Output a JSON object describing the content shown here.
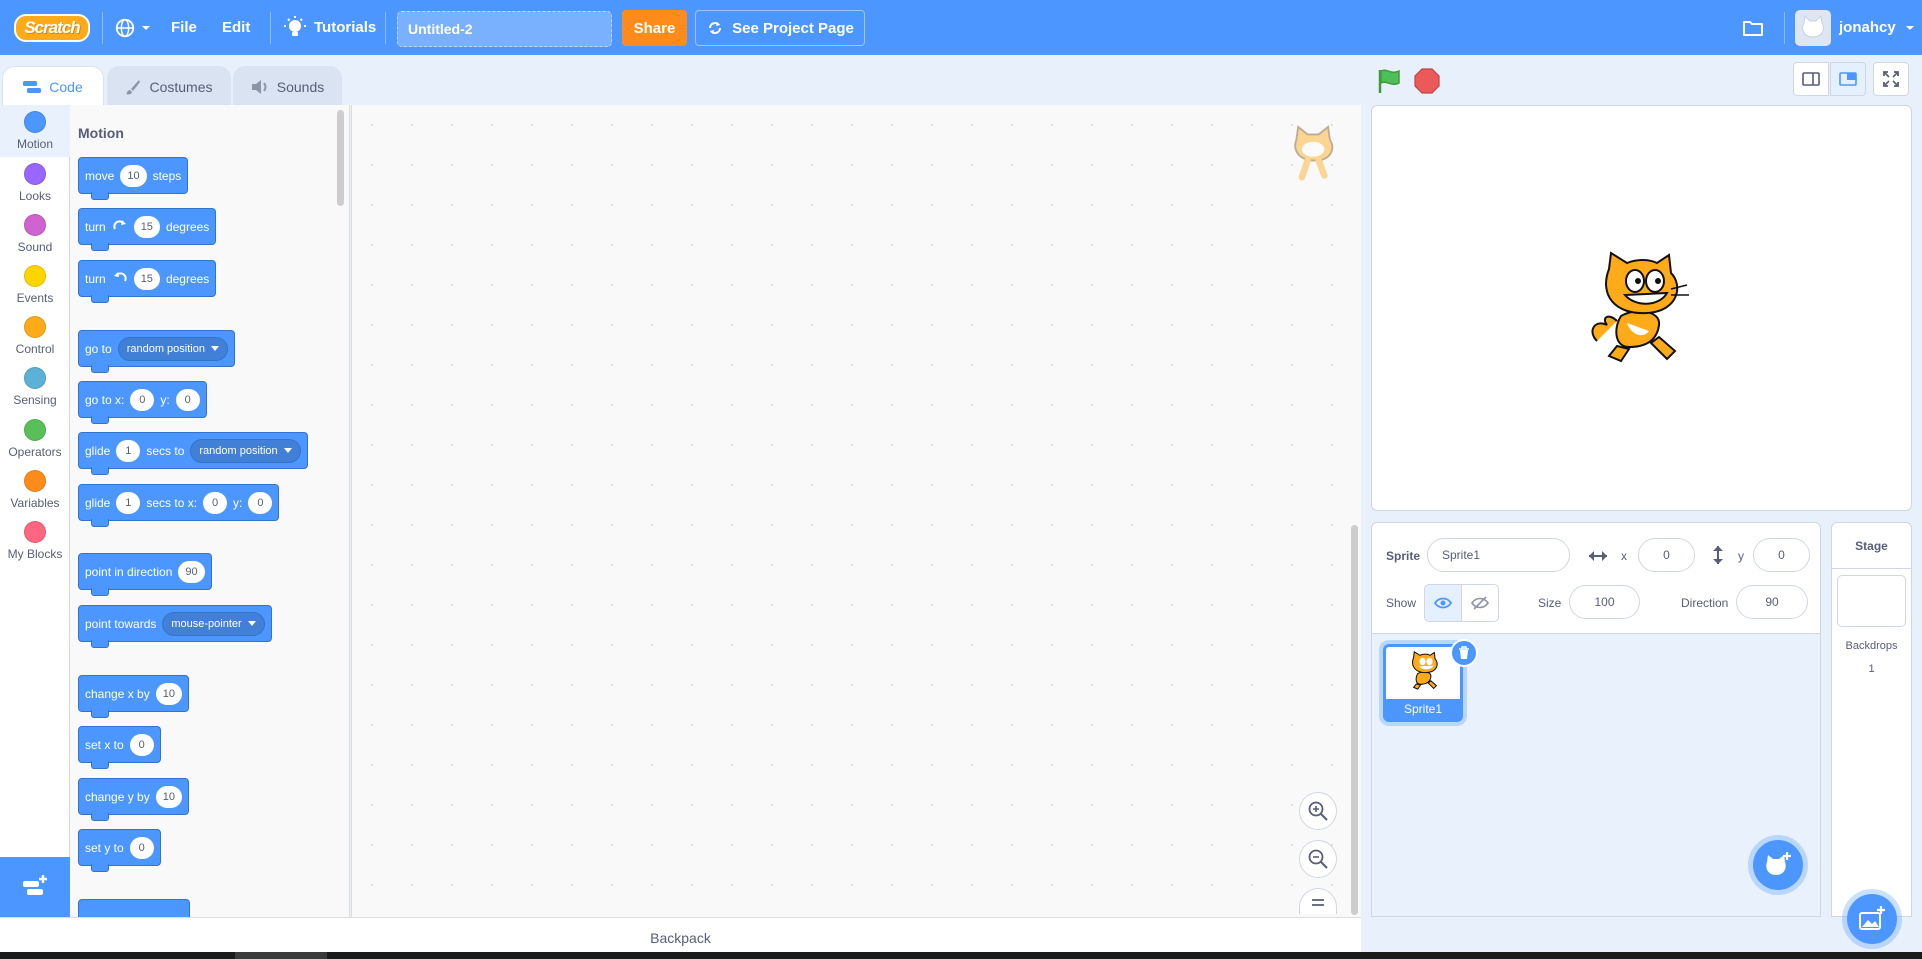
{
  "menubar": {
    "logo_text": "Scratch",
    "file_label": "File",
    "edit_label": "Edit",
    "tutorials_label": "Tutorials",
    "project_title": "Untitled-2",
    "share_label": "Share",
    "see_project_label": "See Project Page",
    "username": "jonahcy",
    "accent": "#4c97ff",
    "share_color": "#ff8c1a"
  },
  "tabs": {
    "code": "Code",
    "costumes": "Costumes",
    "sounds": "Sounds"
  },
  "categories": [
    {
      "label": "Motion",
      "color": "#4c97ff"
    },
    {
      "label": "Looks",
      "color": "#9966ff"
    },
    {
      "label": "Sound",
      "color": "#cf63cf"
    },
    {
      "label": "Events",
      "color": "#ffd500"
    },
    {
      "label": "Control",
      "color": "#ffab19"
    },
    {
      "label": "Sensing",
      "color": "#5cb1d6"
    },
    {
      "label": "Operators",
      "color": "#59c059"
    },
    {
      "label": "Variables",
      "color": "#ff8c1a"
    },
    {
      "label": "My Blocks",
      "color": "#ff6680"
    }
  ],
  "palette": {
    "section_title": "Motion",
    "move": {
      "a": "move",
      "v": "10",
      "b": "steps"
    },
    "turn_right": {
      "a": "turn",
      "v": "15",
      "b": "degrees"
    },
    "turn_left": {
      "a": "turn",
      "v": "15",
      "b": "degrees"
    },
    "goto": {
      "a": "go to",
      "menu": "random position"
    },
    "goto_xy": {
      "a": "go to x:",
      "x": "0",
      "b": "y:",
      "y": "0"
    },
    "glide_to": {
      "a": "glide",
      "v": "1",
      "b": "secs to",
      "menu": "random position"
    },
    "glide_xy": {
      "a": "glide",
      "v": "1",
      "b": "secs to x:",
      "x": "0",
      "c": "y:",
      "y": "0"
    },
    "point_dir": {
      "a": "point in direction",
      "v": "90"
    },
    "point_towards": {
      "a": "point towards",
      "menu": "mouse-pointer"
    },
    "change_x": {
      "a": "change x by",
      "v": "10"
    },
    "set_x": {
      "a": "set x to",
      "v": "0"
    },
    "change_y": {
      "a": "change y by",
      "v": "10"
    },
    "set_y": {
      "a": "set y to",
      "v": "0"
    }
  },
  "backpack_label": "Backpack",
  "sprite_info": {
    "sprite_label": "Sprite",
    "sprite_name": "Sprite1",
    "x_label": "x",
    "x_value": "0",
    "y_label": "y",
    "y_value": "0",
    "show_label": "Show",
    "size_label": "Size",
    "size_value": "100",
    "direction_label": "Direction",
    "direction_value": "90"
  },
  "sprites": [
    {
      "name": "Sprite1"
    }
  ],
  "stage_pane": {
    "title": "Stage",
    "backdrops_label": "Backdrops",
    "backdrops_count": "1"
  }
}
